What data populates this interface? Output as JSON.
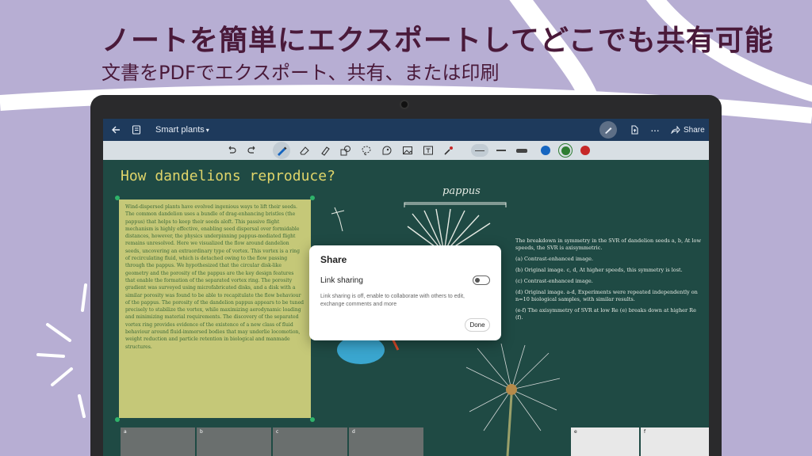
{
  "headline": "ノートを簡単にエクスポートしてどこでも共有可能",
  "subheadline": "文書をPDFでエクスポート、共有、または印刷",
  "colors": {
    "background": "#b7aed3",
    "headline": "#4a1a3a",
    "titlebar": "#1e3a5c",
    "board": "#1f4a44",
    "note_fill": "#c5c878",
    "ink_blue": "#1565c0",
    "ink_green": "#2e7d32",
    "ink_red": "#c62828"
  },
  "app": {
    "back_icon": "back-arrow-icon",
    "notebook_name": "Smart plants",
    "share_label": "Share",
    "toolbar_icons": [
      "undo-icon",
      "redo-icon",
      "pen-icon",
      "eraser-icon",
      "highlighter-icon",
      "shapes-icon",
      "lasso-icon",
      "sticker-icon",
      "image-icon",
      "text-icon",
      "laser-pointer-icon"
    ]
  },
  "document": {
    "title": "How dandelions reproduce?",
    "pappus_label": "pappus",
    "note_text": "Wind-dispersed plants have evolved ingenious ways to lift their seeds. The common dandelion uses a bundle of drag-enhancing bristles (the pappus) that helps to keep their seeds aloft. This passive flight mechanism is highly effective, enabling seed dispersal over formidable distances, however, the physics underpinning pappus-mediated flight remains unresolved. Here we visualized the flow around dandelion seeds, uncovering an extraordinary type of vortex. This vortex is a ring of recirculating fluid, which is detached owing to the flow passing through the pappus. We hypothesized that the circular disk-like geometry and the porosity of the pappus are the key design features that enable the formation of the separated vortex ring. The porosity gradient was surveyed using microfabricated disks, and a disk with a similar porosity was found to be able to recapitulate the flow behaviour of the pappus. The porosity of the dandelion pappus appears to be tuned precisely to stabilize the vortex, while maximizing aerodynamic loading and minimizing material requirements. The discovery of the separated vortex ring provides evidence of the existence of a new class of fluid behaviour around fluid-immersed bodies that may underlie locomotion, weight reduction and particle retention in biological and manmade structures.",
    "right_intro": "The breakdown in symmetry in the SVR of dandelion seeds a, b, At low speeds, the SVR is axisymmetric.",
    "right_items": [
      {
        "marker": "a",
        "text": "Contrast-enhanced image."
      },
      {
        "marker": "b",
        "text": "Original image. c, d, At higher speeds, this symmetry is lost."
      },
      {
        "marker": "c",
        "text": "Contrast-enhanced image."
      },
      {
        "marker": "d",
        "text": "Original image. a-d, Experiments were repeated independently on n=10 biological samples, with similar results."
      },
      {
        "marker": "e-f",
        "text": "The axisymmetry of SVR at low Re (e) breaks down at higher Re (f)."
      }
    ],
    "thumb_labels": [
      "a",
      "b",
      "c",
      "d"
    ],
    "thumb_labels_right": [
      "e",
      "f"
    ]
  },
  "share_dialog": {
    "title": "Share",
    "link_sharing_label": "Link sharing",
    "link_sharing_enabled": false,
    "description": "Link sharing is off, enable to collaborate with others to edit, exchange comments and more",
    "done_label": "Done"
  }
}
